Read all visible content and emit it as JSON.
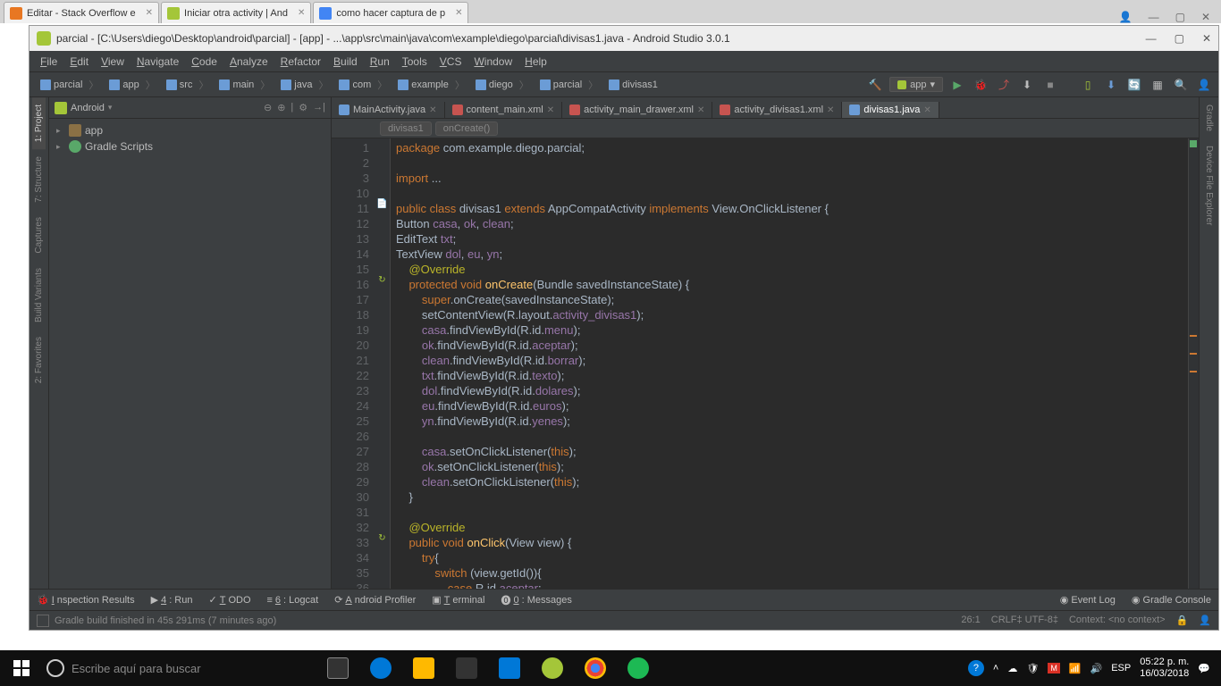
{
  "chrome": {
    "tabs": [
      {
        "label": "Editar - Stack Overflow e"
      },
      {
        "label": "Iniciar otra activity | And"
      },
      {
        "label": "como hacer captura de p"
      }
    ],
    "sys": [
      "👤",
      "—",
      "▢",
      "✕"
    ]
  },
  "title": "parcial - [C:\\Users\\diego\\Desktop\\android\\parcial] - [app] - ...\\app\\src\\main\\java\\com\\example\\diego\\parcial\\divisas1.java - Android Studio 3.0.1",
  "menu": [
    "File",
    "Edit",
    "View",
    "Navigate",
    "Code",
    "Analyze",
    "Refactor",
    "Build",
    "Run",
    "Tools",
    "VCS",
    "Window",
    "Help"
  ],
  "breadcrumbs": [
    "parcial",
    "app",
    "src",
    "main",
    "java",
    "com",
    "example",
    "diego",
    "parcial",
    "divisas1"
  ],
  "run_config": "app",
  "left_tabs": [
    "1: Project",
    "7: Structure",
    "Captures",
    "Build Variants",
    "2: Favorites"
  ],
  "right_tabs": [
    "Gradle",
    "Device File Explorer"
  ],
  "project_pane": {
    "title": "Android",
    "items": [
      {
        "label": "app",
        "icon": "folder"
      },
      {
        "label": "Gradle Scripts",
        "icon": "gradle"
      }
    ]
  },
  "editor_tabs": [
    {
      "label": "MainActivity.java",
      "icon": "java"
    },
    {
      "label": "content_main.xml",
      "icon": "xml"
    },
    {
      "label": "activity_main_drawer.xml",
      "icon": "xml"
    },
    {
      "label": "activity_divisas1.xml",
      "icon": "xml"
    },
    {
      "label": "divisas1.java",
      "icon": "java",
      "active": true
    }
  ],
  "breadcrumb2": [
    "divisas1",
    "onCreate()"
  ],
  "code": {
    "first_line": 1,
    "lines": [
      {
        "n": 1,
        "html": "<span class='kw'>package</span> <span class='norm'>com.example.diego.parcial;</span>"
      },
      {
        "n": 2,
        "html": ""
      },
      {
        "n": 3,
        "html": "<span class='kw'>import</span> <span class='norm'>...</span>",
        "fold": "+"
      },
      {
        "n": 10,
        "html": ""
      },
      {
        "n": 11,
        "html": "<span class='kw'>public class</span> <span class='norm'>divisas1</span> <span class='kw'>extends</span> <span class='norm'>AppCompatActivity</span> <span class='kw'>implements</span> <span class='norm'>View.OnClickListener {</span>",
        "icon": "📄"
      },
      {
        "n": 12,
        "html": "<span class='norm'>Button </span><span class='field'>casa</span><span class='norm'>, </span><span class='field'>ok</span><span class='norm'>, </span><span class='field'>clean</span><span class='norm'>;</span>"
      },
      {
        "n": 13,
        "html": "<span class='norm'>EditText </span><span class='field'>txt</span><span class='norm'>;</span>"
      },
      {
        "n": 14,
        "html": "<span class='norm'>TextView </span><span class='field'>dol</span><span class='norm'>, </span><span class='field'>eu</span><span class='norm'>, </span><span class='field'>yn</span><span class='norm'>;</span>"
      },
      {
        "n": 15,
        "html": "    <span class='ann'>@Override</span>"
      },
      {
        "n": 16,
        "html": "    <span class='kw'>protected void</span> <span class='fn'>onCreate</span><span class='norm'>(Bundle savedInstanceState) {</span>",
        "icon": "↻"
      },
      {
        "n": 17,
        "html": "        <span class='kw'>super</span><span class='norm'>.onCreate(savedInstanceState);</span>"
      },
      {
        "n": 18,
        "html": "        <span class='norm'>setContentView(R.layout.</span><span class='field'>activity_divisas1</span><span class='norm'>);</span>"
      },
      {
        "n": 19,
        "html": "        <span class='field'>casa</span><span class='norm'>.findViewById(R.id.</span><span class='field'>menu</span><span class='norm'>);</span>"
      },
      {
        "n": 20,
        "html": "        <span class='field'>ok</span><span class='norm'>.findViewById(R.id.</span><span class='field'>aceptar</span><span class='norm'>);</span>"
      },
      {
        "n": 21,
        "html": "        <span class='field'>clean</span><span class='norm'>.findViewById(R.id.</span><span class='field'>borrar</span><span class='norm'>);</span>"
      },
      {
        "n": 22,
        "html": "        <span class='field'>txt</span><span class='norm'>.findViewById(R.id.</span><span class='field'>texto</span><span class='norm'>);</span>"
      },
      {
        "n": 23,
        "html": "        <span class='field'>dol</span><span class='norm'>.findViewById(R.id.</span><span class='field'>dolares</span><span class='norm'>);</span>"
      },
      {
        "n": 24,
        "html": "        <span class='field'>eu</span><span class='norm'>.findViewById(R.id.</span><span class='field'>euros</span><span class='norm'>);</span>"
      },
      {
        "n": 25,
        "html": "        <span class='field'>yn</span><span class='norm'>.findViewById(R.id.</span><span class='field'>yenes</span><span class='norm'>);</span>"
      },
      {
        "n": 26,
        "html": ""
      },
      {
        "n": 27,
        "html": "        <span class='field'>casa</span><span class='norm'>.setOnClickListener(</span><span class='kw'>this</span><span class='norm'>);</span>"
      },
      {
        "n": 28,
        "html": "        <span class='field'>ok</span><span class='norm'>.setOnClickListener(</span><span class='kw'>this</span><span class='norm'>);</span>"
      },
      {
        "n": 29,
        "html": "        <span class='field'>clean</span><span class='norm'>.setOnClickListener(</span><span class='kw'>this</span><span class='norm'>);</span>"
      },
      {
        "n": 30,
        "html": "    <span class='norm'>}</span>"
      },
      {
        "n": 31,
        "html": ""
      },
      {
        "n": 32,
        "html": "    <span class='ann'>@Override</span>"
      },
      {
        "n": 33,
        "html": "    <span class='kw'>public void</span> <span class='fn'>onClick</span><span class='norm'>(View view) {</span>",
        "icon": "↻"
      },
      {
        "n": 34,
        "html": "        <span class='kw'>try</span><span class='norm'>{</span>"
      },
      {
        "n": 35,
        "html": "            <span class='kw'>switch</span> <span class='norm'>(view.getId()){</span>"
      },
      {
        "n": 36,
        "html": "                <span class='kw'>case</span> <span class='norm'>R.id.</span><span class='field'>aceptar</span><span class='norm'>:</span>"
      }
    ]
  },
  "bottom_tools": {
    "left": [
      "Inspection Results",
      "4: Run",
      "TODO",
      "6: Logcat",
      "Android Profiler",
      "Terminal",
      "0: Messages"
    ],
    "right": [
      "Event Log",
      "Gradle Console"
    ]
  },
  "status": {
    "msg": "Gradle build finished in 45s 291ms (7 minutes ago)",
    "pos": "26:1",
    "enc": "CRLF‡   UTF-8‡",
    "ctx": "Context: <no context>"
  },
  "tray": {
    "lang": "ESP",
    "time": "05:22 p. m.",
    "date": "16/03/2018"
  },
  "search_ph": "Escribe aquí para buscar"
}
